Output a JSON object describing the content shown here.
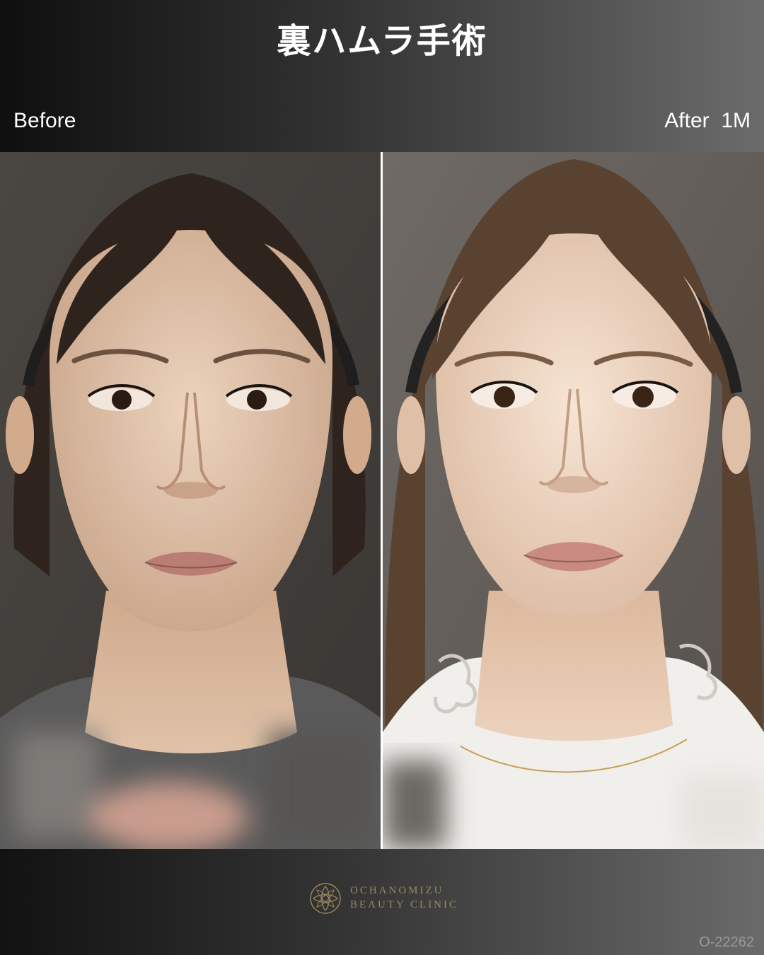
{
  "header": {
    "title": "裏ハムラ手術",
    "before_label": "Before",
    "after_label": "After  1M"
  },
  "photos": {
    "before": {
      "icon": "face-photo-before-icon"
    },
    "after": {
      "icon": "face-photo-after-icon"
    }
  },
  "footer": {
    "logo_line1": "OCHANOMIZU",
    "logo_line2": "BEAUTY CLINIC",
    "logo_icon": "clinic-flower-logo-icon",
    "case_id": "O-22262"
  },
  "colors": {
    "logo_gold": "#b8a16a",
    "text_white": "#ffffff"
  }
}
